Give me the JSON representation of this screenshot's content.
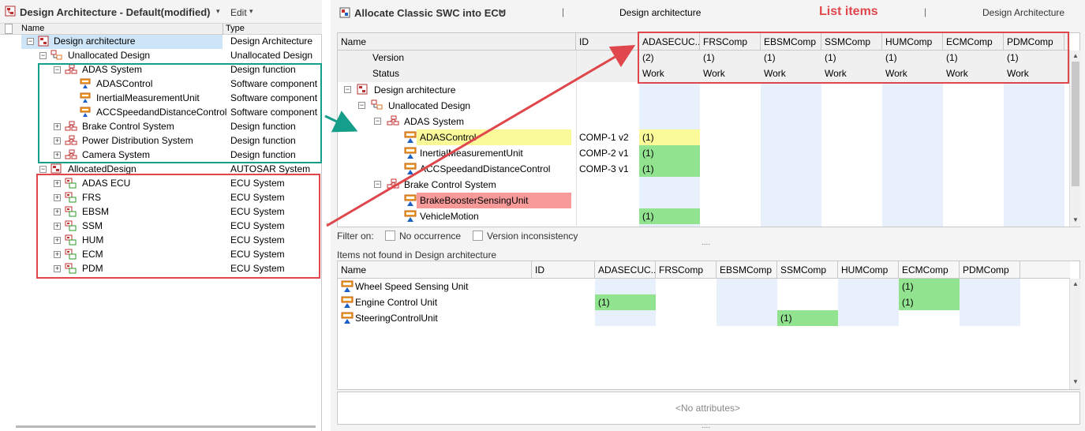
{
  "left": {
    "title": "Design Architecture - Default(modified)",
    "title_caret": "▾",
    "edit_menu": "Edit",
    "edit_caret": "▾",
    "col_name": "Name",
    "col_type": "Type",
    "rows": [
      {
        "name": "Design architecture",
        "type": "Design Architecture"
      },
      {
        "name": "Unallocated Design",
        "type": "Unallocated Design"
      },
      {
        "name": "ADAS System",
        "type": "Design function"
      },
      {
        "name": "ADASControl",
        "type": "Software component"
      },
      {
        "name": "InertialMeasurementUnit",
        "type": "Software component"
      },
      {
        "name": "ACCSpeedandDistanceControl",
        "type": "Software component"
      },
      {
        "name": "Brake Control System",
        "type": "Design function"
      },
      {
        "name": "Power Distribution System",
        "type": "Design function"
      },
      {
        "name": "Camera System",
        "type": "Design function"
      },
      {
        "name": "AllocatedDesign",
        "type": "AUTOSAR System"
      },
      {
        "name": "ADAS ECU",
        "type": "ECU System"
      },
      {
        "name": "FRS",
        "type": "ECU System"
      },
      {
        "name": "EBSM",
        "type": "ECU System"
      },
      {
        "name": "SSM",
        "type": "ECU System"
      },
      {
        "name": "HUM",
        "type": "ECU System"
      },
      {
        "name": "ECM",
        "type": "ECU System"
      },
      {
        "name": "PDM",
        "type": "ECU System"
      }
    ]
  },
  "right": {
    "title": "Allocate Classic SWC into ECU",
    "title_caret": "▾",
    "center_label": "Design architecture",
    "list_items_label": "List items",
    "right_label": "Design Architecture",
    "sep": "|",
    "grid": {
      "col_name": "Name",
      "col_id": "ID",
      "ecu_columns": [
        "ADASECUC...",
        "FRSComp",
        "EBSMComp",
        "SSMComp",
        "HUMComp",
        "ECMComp",
        "PDMComp"
      ],
      "version_label": "Version",
      "status_label": "Status",
      "versions": [
        "(2)",
        "(1)",
        "(1)",
        "(1)",
        "(1)",
        "(1)",
        "(1)"
      ],
      "statuses": [
        "Work",
        "Work",
        "Work",
        "Work",
        "Work",
        "Work",
        "Work"
      ],
      "rows": [
        {
          "name": "Design architecture",
          "id": ""
        },
        {
          "name": "Unallocated Design",
          "id": ""
        },
        {
          "name": "ADAS System",
          "id": ""
        },
        {
          "name": "ADASControl",
          "id": "COMP-1 v2",
          "mark": "(1)"
        },
        {
          "name": "InertialMeasurementUnit",
          "id": "COMP-2 v1",
          "mark": "(1)"
        },
        {
          "name": "ACCSpeedandDistanceControl",
          "id": "COMP-3 v1",
          "mark": "(1)"
        },
        {
          "name": "Brake Control System",
          "id": ""
        },
        {
          "name": "BrakeBoosterSensingUnit",
          "id": ""
        },
        {
          "name": "VehicleMotion",
          "id": "",
          "mark": "(1)"
        }
      ]
    },
    "filter": {
      "label": "Filter on:",
      "no_occurrence": "No occurrence",
      "version_inconsistency": "Version inconsistency"
    },
    "dots": "....",
    "not_found": {
      "title": "Items not found in Design architecture",
      "col_name": "Name",
      "col_id": "ID",
      "ecu_columns": [
        "ADASECUC...",
        "FRSComp",
        "EBSMComp",
        "SSMComp",
        "HUMComp",
        "ECMComp",
        "PDMComp"
      ],
      "rows": [
        {
          "name": "Wheel Speed Sensing Unit",
          "mark": "(1)"
        },
        {
          "name": "Engine Control Unit",
          "mark_a": "(1)",
          "mark_b": "(1)"
        },
        {
          "name": "SteeringControlUnit",
          "mark": "(1)"
        }
      ]
    },
    "no_attributes": "<No attributes>"
  },
  "colors": {
    "green_cell": "#92e38f",
    "yellow_cell": "#fafa9a",
    "red_cell": "#f79a9a",
    "blue_col": "#e8f0fc",
    "red_annotation": "#e0474c",
    "teal_annotation": "#159e8a",
    "selection": "#cde5f7"
  },
  "icons": {
    "design": "design-architecture-icon",
    "unallocated": "unallocated-design-icon",
    "function": "design-function-icon",
    "component": "software-component-icon",
    "autosar": "autosar-system-icon",
    "ecu": "ecu-system-icon",
    "close": "close-icon"
  }
}
